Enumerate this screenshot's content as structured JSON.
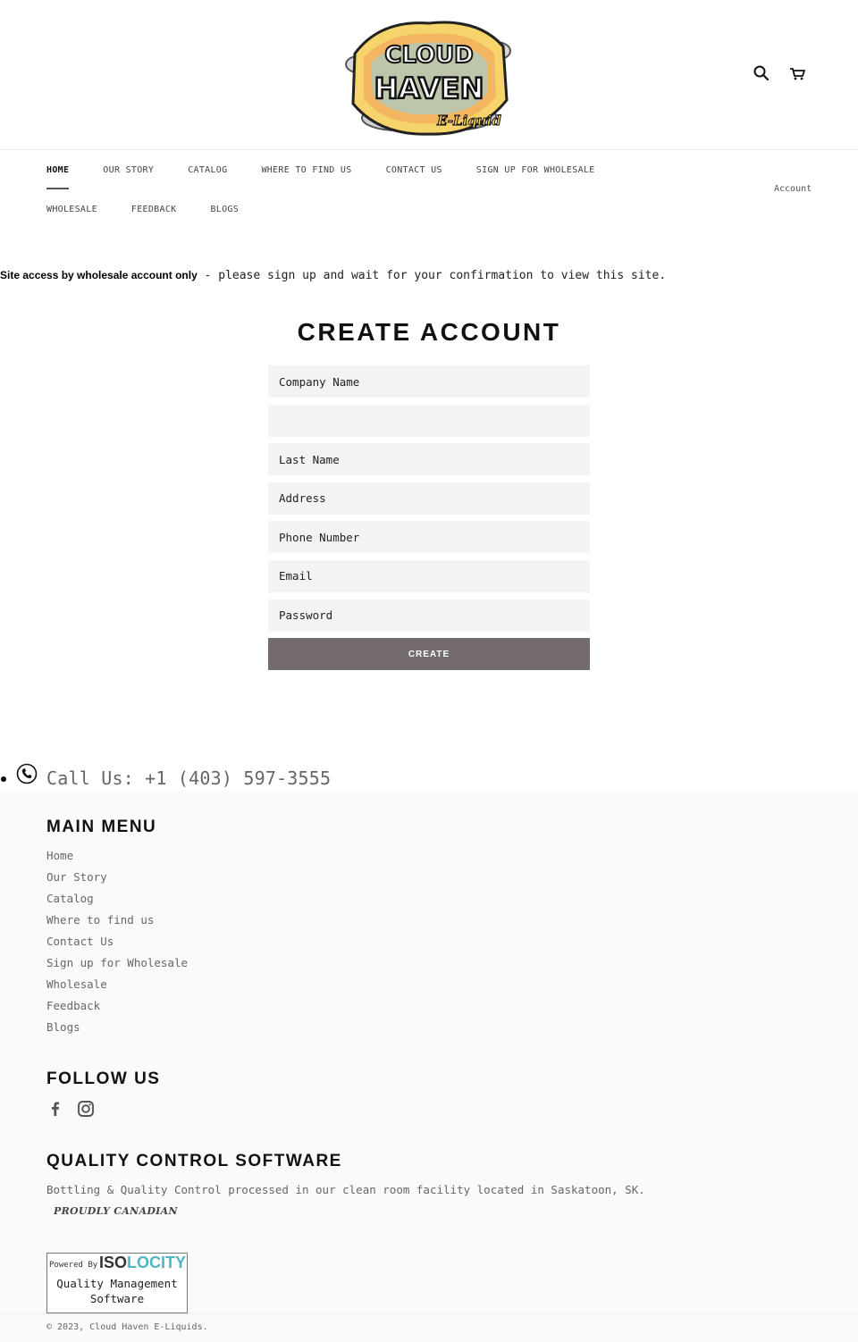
{
  "header": {
    "logo_main": "CLOUD HAVEN",
    "logo_sub": "E-Liquid",
    "search_icon": "search-icon",
    "cart_icon": "cart-icon"
  },
  "nav": {
    "row1": [
      "HOME",
      "OUR STORY",
      "CATALOG",
      "WHERE TO FIND US",
      "CONTACT US",
      "SIGN UP FOR WHOLESALE"
    ],
    "row2": [
      "WHOLESALE",
      "FEEDBACK",
      "BLOGS"
    ],
    "active": "HOME",
    "account": "Account"
  },
  "notice": {
    "bold": "Site access by wholesale account only",
    "text": " - please sign up and wait for your confirmation to view this site."
  },
  "form": {
    "title": "CREATE ACCOUNT",
    "fields": {
      "company": "Company Name",
      "blank": "",
      "last_name": "Last Name",
      "address": "Address",
      "phone": "Phone Number",
      "email": "Email",
      "password": "Password"
    },
    "submit": "CREATE"
  },
  "callus": {
    "text": "Call Us: +1 (403) 597-3555",
    "icon": "phone-icon"
  },
  "footer": {
    "main_menu_title": "MAIN MENU",
    "main_menu": [
      "Home",
      "Our Story",
      "Catalog",
      "Where to find us",
      "Contact Us",
      "Sign up for Wholesale",
      "Wholesale",
      "Feedback",
      "Blogs"
    ],
    "follow_title": "FOLLOW US",
    "social_icons": [
      "facebook-icon",
      "instagram-icon"
    ],
    "qc_title": "QUALITY CONTROL SOFTWARE",
    "qc_text": "Bottling & Quality Control processed in our clean room facility located in Saskatoon, SK.",
    "proud": "PROUDLY CANADIAN",
    "badge": {
      "powered": "Powered By",
      "logo_iso": "ISO",
      "logo_locity": "LOCITY",
      "caption_line1": "Quality Management",
      "caption_line2": "Software"
    },
    "copyright": "© 2023, Cloud Haven E-Liquids."
  },
  "colors": {
    "button": "#736b6f",
    "field_bg": "#f3f3f3",
    "footer_bg": "#fafafa",
    "accent_teal": "#4fb5c0"
  }
}
